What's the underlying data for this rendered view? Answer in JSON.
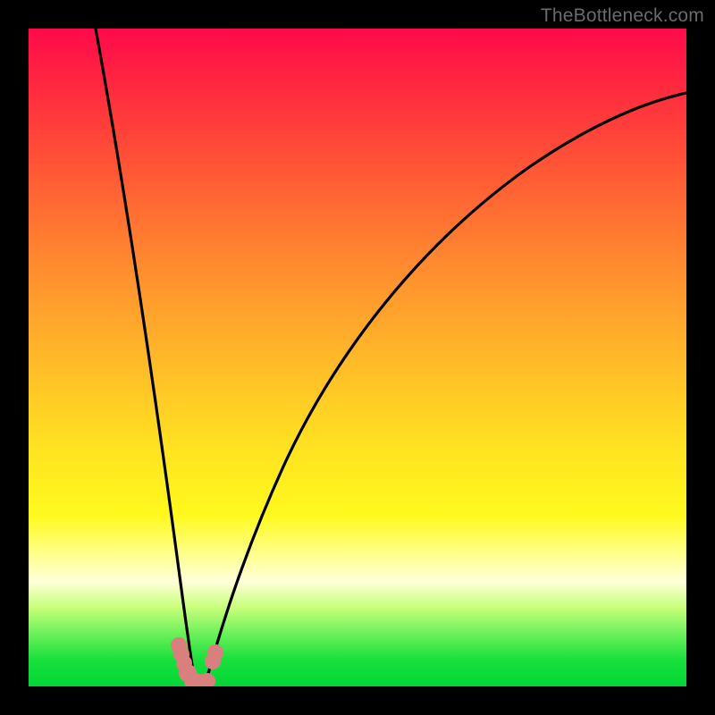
{
  "watermark": {
    "text": "TheBottleneck.com"
  },
  "colors": {
    "gradient_top": "#ff0a4a",
    "gradient_bottom": "#03d637",
    "curve_stroke": "#000000",
    "marker_fill": "#d97f7e"
  },
  "chart_data": {
    "type": "line",
    "title": "",
    "xlabel": "",
    "ylabel": "",
    "xlim": [
      0,
      100
    ],
    "ylim": [
      0,
      100
    ],
    "grid": false,
    "series": [
      {
        "name": "left-branch",
        "x": [
          10,
          12,
          14,
          16,
          18,
          20,
          21,
          22,
          23,
          24,
          24.5
        ],
        "y": [
          100,
          85,
          70,
          56,
          42,
          28,
          21,
          15,
          9,
          4,
          0
        ]
      },
      {
        "name": "right-branch",
        "x": [
          26.5,
          28,
          30,
          33,
          37,
          42,
          48,
          55,
          63,
          72,
          82,
          92,
          100
        ],
        "y": [
          0,
          6,
          14,
          24,
          35,
          46,
          56,
          64,
          72,
          78,
          83,
          87,
          90
        ]
      }
    ],
    "markers": {
      "name": "highlight-points",
      "points": [
        {
          "x": 22.5,
          "y": 6
        },
        {
          "x": 23.0,
          "y": 4
        },
        {
          "x": 23.5,
          "y": 2
        },
        {
          "x": 24.0,
          "y": 1
        },
        {
          "x": 24.7,
          "y": 0
        },
        {
          "x": 25.5,
          "y": 0
        },
        {
          "x": 26.3,
          "y": 0
        },
        {
          "x": 27.5,
          "y": 3
        },
        {
          "x": 28.0,
          "y": 5
        }
      ]
    }
  }
}
